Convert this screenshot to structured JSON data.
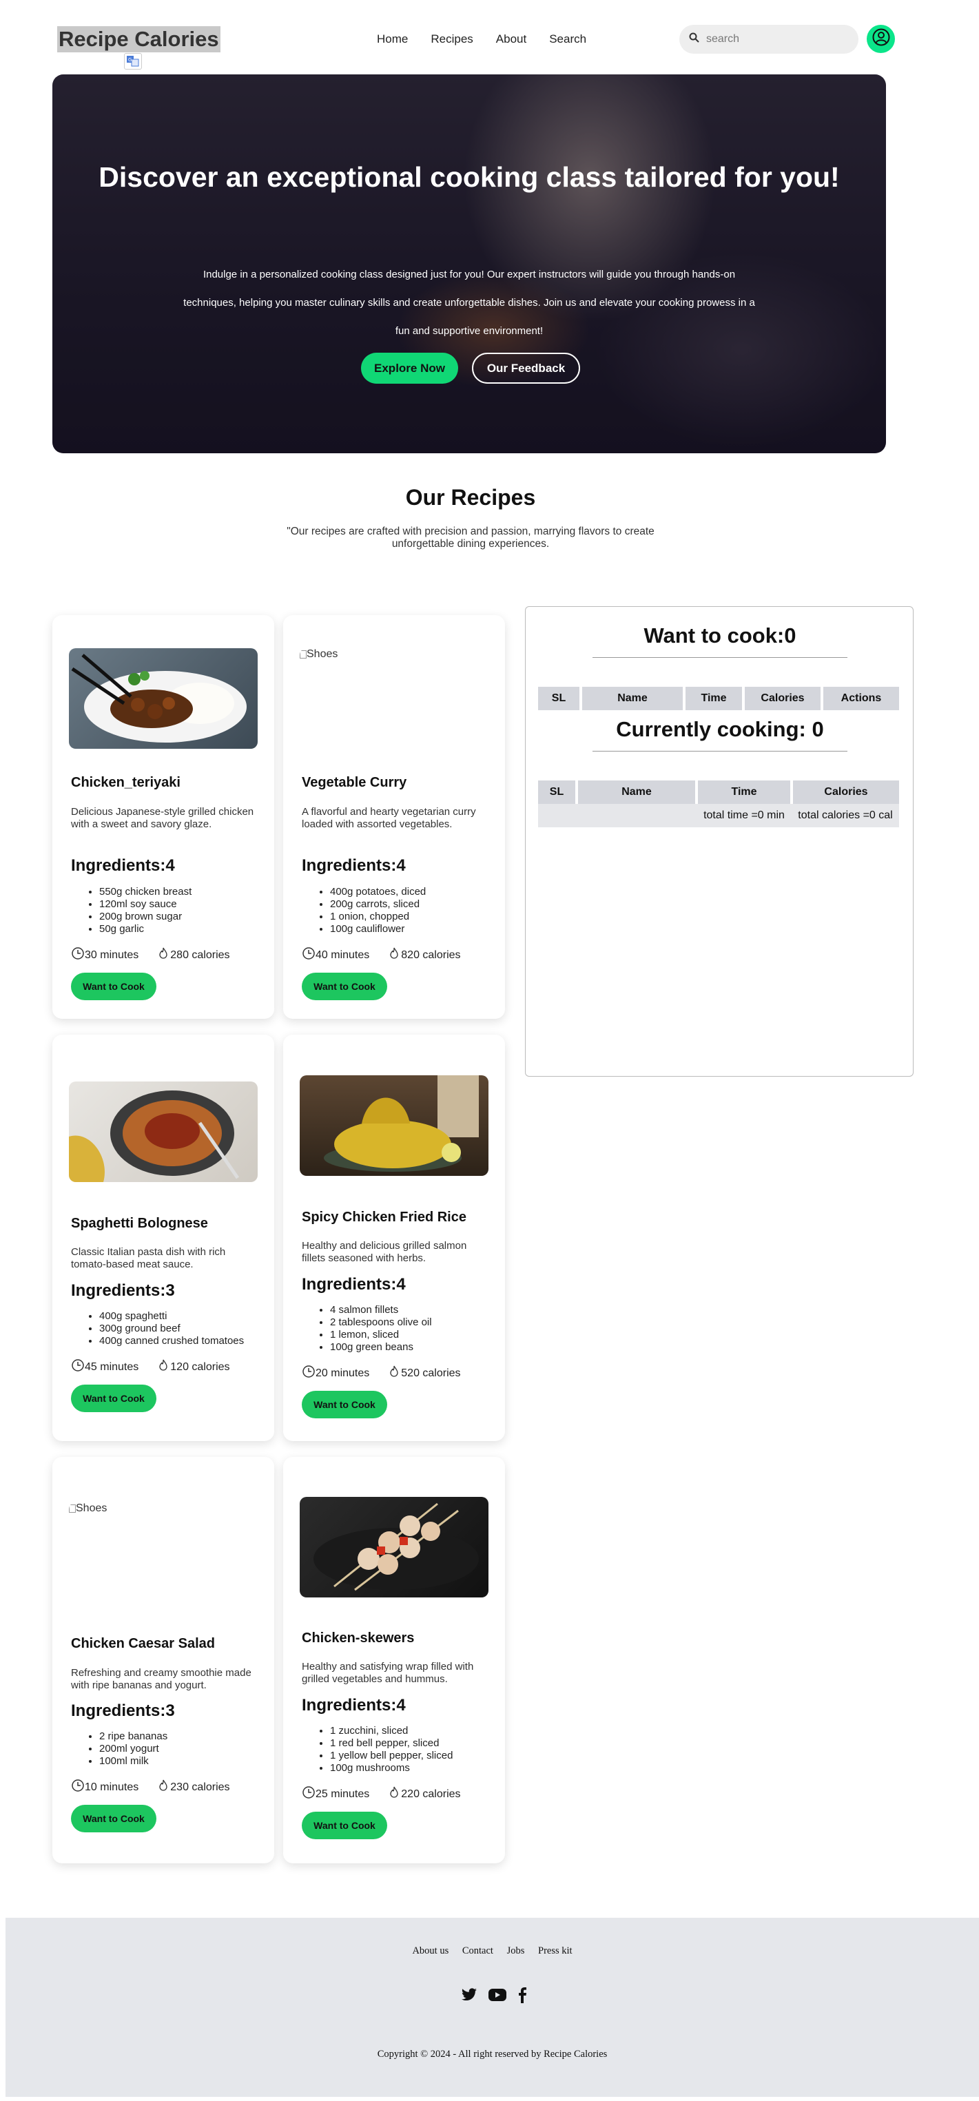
{
  "header": {
    "logo": "Recipe Calories",
    "nav": [
      "Home",
      "Recipes",
      "About",
      "Search"
    ],
    "search_placeholder": "search"
  },
  "hero": {
    "title": "Discover an exceptional cooking class tailored for you!",
    "text": "Indulge in a personalized cooking class designed just for you! Our expert instructors will guide you through hands-on techniques, helping you master culinary skills and create unforgettable dishes. Join us and elevate your cooking prowess in a fun and supportive environment!",
    "explore_label": "Explore Now",
    "feedback_label": "Our Feedback"
  },
  "recipes_section": {
    "title": "Our Recipes",
    "subtitle": "\"Our recipes are crafted with precision and passion, marrying flavors to create unforgettable dining experiences."
  },
  "recipes": [
    {
      "name": "Chicken_teriyaki",
      "description": "Delicious Japanese-style grilled chicken with a sweet and savory glaze.",
      "ingredients_title": "Ingredients:4",
      "ingredients": [
        "550g chicken breast",
        "120ml soy sauce",
        "200g brown sugar",
        "50g garlic"
      ],
      "time": "30 minutes",
      "calories": "280 calories",
      "button": "Want to Cook",
      "image_alt": ""
    },
    {
      "name": "Vegetable Curry",
      "description": "A flavorful and hearty vegetarian curry loaded with assorted vegetables.",
      "ingredients_title": "Ingredients:4",
      "ingredients": [
        "400g potatoes, diced",
        "200g carrots, sliced",
        "1 onion, chopped",
        "100g cauliflower"
      ],
      "time": "40 minutes",
      "calories": "820 calories",
      "button": "Want to Cook",
      "image_alt": "Shoes"
    },
    {
      "name": "Spaghetti Bolognese",
      "description": "Classic Italian pasta dish with rich tomato-based meat sauce.",
      "ingredients_title": "Ingredients:3",
      "ingredients": [
        "400g spaghetti",
        "300g ground beef",
        "400g canned crushed tomatoes"
      ],
      "time": "45 minutes",
      "calories": "120 calories",
      "button": "Want to Cook",
      "image_alt": ""
    },
    {
      "name": "Spicy Chicken Fried Rice",
      "description": "Healthy and delicious grilled salmon fillets seasoned with herbs.",
      "ingredients_title": "Ingredients:4",
      "ingredients": [
        "4 salmon fillets",
        "2 tablespoons olive oil",
        "1 lemon, sliced",
        "100g green beans"
      ],
      "time": "20 minutes",
      "calories": "520 calories",
      "button": "Want to Cook",
      "image_alt": ""
    },
    {
      "name": "Chicken Caesar Salad",
      "description": "Refreshing and creamy smoothie made with ripe bananas and yogurt.",
      "ingredients_title": "Ingredients:3",
      "ingredients": [
        "2 ripe bananas",
        "200ml yogurt",
        "100ml milk"
      ],
      "time": "10 minutes",
      "calories": "230 calories",
      "button": "Want to Cook",
      "image_alt": "Shoes"
    },
    {
      "name": "Chicken-skewers",
      "description": "Healthy and satisfying wrap filled with grilled vegetables and hummus.",
      "ingredients_title": "Ingredients:4",
      "ingredients": [
        "1 zucchini, sliced",
        "1 red bell pepper, sliced",
        "1 yellow bell pepper, sliced",
        "100g mushrooms"
      ],
      "time": "25 minutes",
      "calories": "220 calories",
      "button": "Want to Cook",
      "image_alt": ""
    }
  ],
  "panel": {
    "want_title": "Want to cook:0",
    "want_headers": [
      "SL",
      "Name",
      "Time",
      "Calories",
      "Actions"
    ],
    "cooking_title": "Currently cooking: 0",
    "cooking_headers": [
      "SL",
      "Name",
      "Time",
      "Calories"
    ],
    "total_time": "total time =0 min",
    "total_calories": "total calories =0 cal"
  },
  "footer": {
    "links": [
      "About us",
      "Contact",
      "Jobs",
      "Press kit"
    ],
    "copyright": "Copyright © 2024 - All right reserved by Recipe Calories"
  },
  "colors": {
    "accent": "#10d775",
    "cook_button": "#1dc65f",
    "footer_bg": "#e5e7eb"
  }
}
